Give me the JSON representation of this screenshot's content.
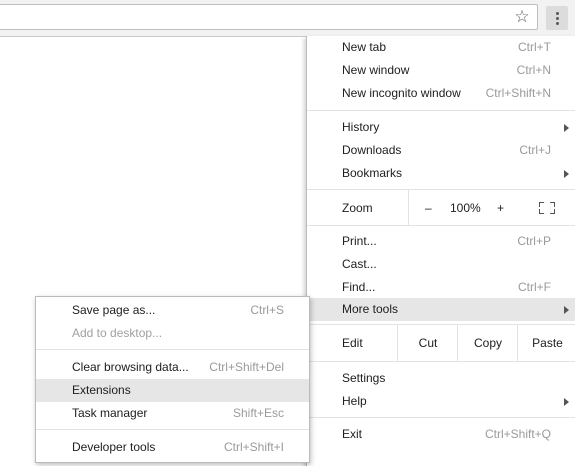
{
  "toolbar": {
    "bookmark_icon": "star-icon",
    "menu_icon": "kebab-menu-icon"
  },
  "menu": {
    "new_tab": {
      "label": "New tab",
      "shortcut": "Ctrl+T"
    },
    "new_window": {
      "label": "New window",
      "shortcut": "Ctrl+N"
    },
    "new_incognito": {
      "label": "New incognito window",
      "shortcut": "Ctrl+Shift+N"
    },
    "history": {
      "label": "History"
    },
    "downloads": {
      "label": "Downloads",
      "shortcut": "Ctrl+J"
    },
    "bookmarks": {
      "label": "Bookmarks"
    },
    "zoom": {
      "label": "Zoom",
      "minus": "–",
      "value": "100%",
      "plus": "+"
    },
    "print": {
      "label": "Print...",
      "shortcut": "Ctrl+P"
    },
    "cast": {
      "label": "Cast..."
    },
    "find": {
      "label": "Find...",
      "shortcut": "Ctrl+F"
    },
    "more_tools": {
      "label": "More tools"
    },
    "edit": {
      "label": "Edit",
      "cut": "Cut",
      "copy": "Copy",
      "paste": "Paste"
    },
    "settings": {
      "label": "Settings"
    },
    "help": {
      "label": "Help"
    },
    "exit": {
      "label": "Exit",
      "shortcut": "Ctrl+Shift+Q"
    }
  },
  "submenu": {
    "save_page": {
      "label": "Save page as...",
      "shortcut": "Ctrl+S"
    },
    "add_desktop": {
      "label": "Add to desktop..."
    },
    "clear_data": {
      "label": "Clear browsing data...",
      "shortcut": "Ctrl+Shift+Del"
    },
    "extensions": {
      "label": "Extensions"
    },
    "task_manager": {
      "label": "Task manager",
      "shortcut": "Shift+Esc"
    },
    "dev_tools": {
      "label": "Developer tools",
      "shortcut": "Ctrl+Shift+I"
    }
  }
}
